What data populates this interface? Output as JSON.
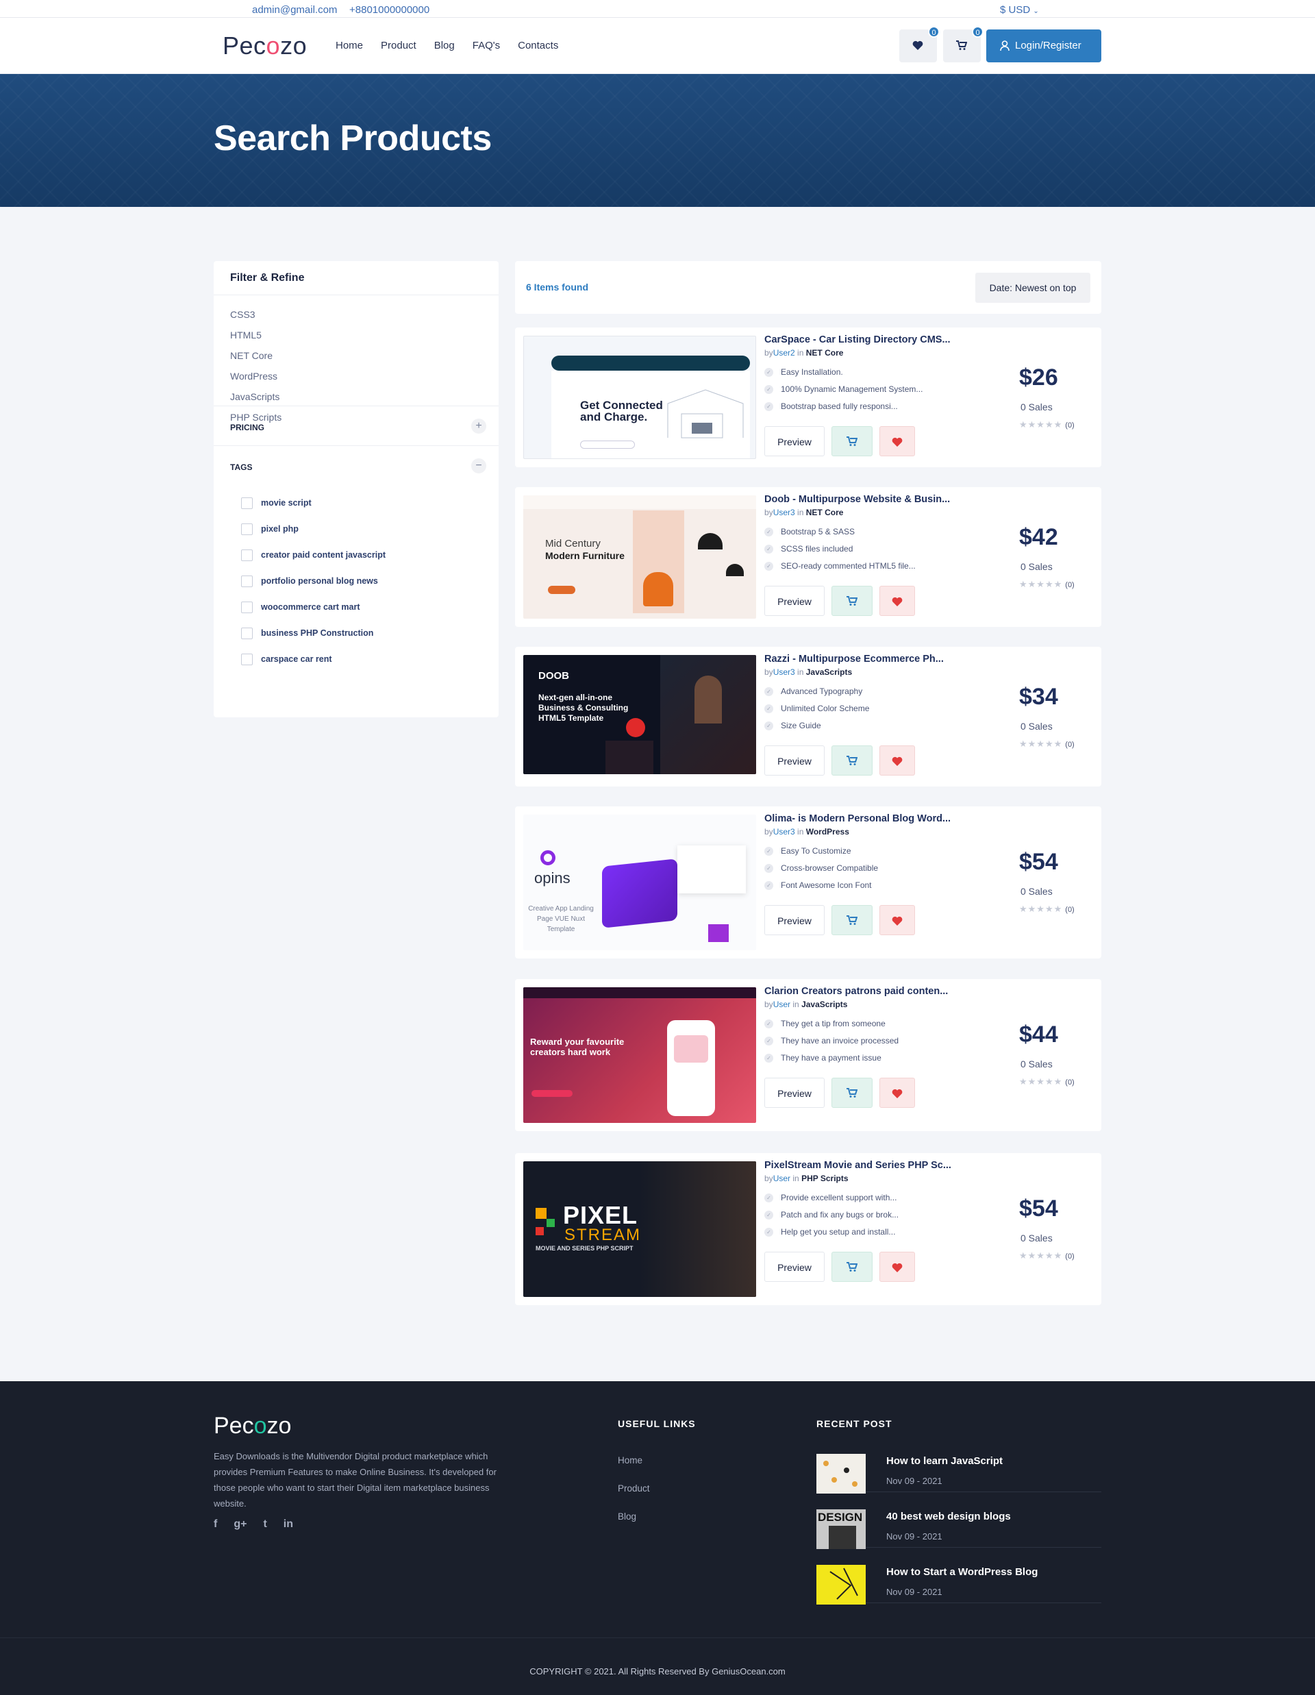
{
  "topbar": {
    "email": "admin@gmail.com",
    "phone": "+8801000000000",
    "currency": "$  USD"
  },
  "header": {
    "logo": "Pecozo",
    "nav": [
      "Home",
      "Product",
      "Blog",
      "FAQ's",
      "Contacts"
    ],
    "wishlist_count": "0",
    "cart_count": "0",
    "login_label": "Login/Register"
  },
  "hero": {
    "title": "Search Products"
  },
  "sidebar": {
    "title": "Filter & Refine",
    "categories": [
      "CSS3",
      "HTML5",
      "NET Core",
      "WordPress",
      "JavaScripts",
      "PHP Scripts"
    ],
    "pricing_label": "PRICING",
    "tags_label": "TAGS",
    "tags": [
      "movie script",
      "pixel php",
      "creator paid content javascript",
      "portfolio personal blog news",
      "woocommerce cart mart",
      "business PHP Construction",
      "carspace car rent"
    ]
  },
  "results": {
    "found": "6 Items found",
    "sort": "Date: Newest on top"
  },
  "products": [
    {
      "name": "CarSpace - Car Listing Directory CMS...",
      "by": "by",
      "user": "User2",
      "in": "in",
      "category": "NET Core",
      "features": [
        "Easy Installation.",
        "100% Dynamic Management System...",
        "Bootstrap based fully responsi..."
      ],
      "price": "$26",
      "sales": "0 Sales",
      "rating": "(0)",
      "thumb_text": "Get Connected and Charge."
    },
    {
      "name": "Doob - Multipurpose Website & Busin...",
      "by": "by",
      "user": "User3",
      "in": "in",
      "category": "NET Core",
      "features": [
        "Bootstrap 5 & SASS",
        "SCSS files included",
        "SEO-ready commented HTML5 file..."
      ],
      "price": "$42",
      "sales": "0 Sales",
      "rating": "(0)",
      "thumb_text": "Mid Century",
      "thumb_text2": "Modern Furniture"
    },
    {
      "name": "Razzi - Multipurpose Ecommerce Ph...",
      "by": "by",
      "user": "User3",
      "in": "in",
      "category": "JavaScripts",
      "features": [
        "Advanced Typography",
        "Unlimited Color Scheme",
        "Size Guide"
      ],
      "price": "$34",
      "sales": "0 Sales",
      "rating": "(0)",
      "thumb_text": "DOOB",
      "thumb_text2": "Next-gen all-in-one Business & Consulting HTML5 Template"
    },
    {
      "name": "Olima- is Modern Personal Blog Word...",
      "by": "by",
      "user": "User3",
      "in": "in",
      "category": "WordPress",
      "features": [
        "Easy To Customize",
        "Cross-browser Compatible",
        "Font Awesome Icon Font"
      ],
      "price": "$54",
      "sales": "0 Sales",
      "rating": "(0)",
      "thumb_text": "opins",
      "thumb_text2": "Creative App Landing Page VUE Nuxt Template"
    },
    {
      "name": "Clarion Creators patrons paid conten...",
      "by": "by",
      "user": "User",
      "in": "in",
      "category": "JavaScripts",
      "features": [
        "They get a tip from someone",
        "They have an invoice processed",
        "They have a payment issue"
      ],
      "price": "$44",
      "sales": "0 Sales",
      "rating": "(0)",
      "thumb_text": "Reward your favourite creators hard work"
    },
    {
      "name": "PixelStream Movie and Series PHP Sc...",
      "by": "by",
      "user": "User",
      "in": "in",
      "category": "PHP Scripts",
      "features": [
        "Provide excellent support with...",
        "Patch and fix any bugs or brok...",
        "Help get you setup and install..."
      ],
      "price": "$54",
      "sales": "0 Sales",
      "rating": "(0)",
      "thumb_text": "PIXEL",
      "thumb_text2": "STREAM",
      "thumb_text3": "MOVIE AND SERIES PHP SCRIPT"
    }
  ],
  "buttons": {
    "preview": "Preview"
  },
  "footer": {
    "logo": "Pecozo",
    "description": "Easy Downloads is the Multivendor Digital product marketplace which provides Premium Features to make Online Business. It's developed for those people who want to start their Digital item marketplace business website.",
    "social": [
      "f",
      "g+",
      "t",
      "in"
    ],
    "useful_links_title": "USEFUL LINKS",
    "useful_links": [
      "Home",
      "Product",
      "Blog"
    ],
    "recent_post_title": "RECENT POST",
    "posts": [
      {
        "title": "How to learn JavaScript",
        "date": "Nov 09 - 2021"
      },
      {
        "title": "40 best web design blogs",
        "date": "Nov 09 - 2021",
        "img_text": "DESIGN"
      },
      {
        "title": "How to Start a WordPress Blog",
        "date": "Nov 09 - 2021"
      }
    ],
    "copyright": "COPYRIGHT © 2021. All Rights Reserved By GeniusOcean.com"
  },
  "colors": {
    "primary": "#2d7cc0",
    "hero": "#1d4473",
    "footer": "#1a1f2b",
    "title": "#1f2f5c"
  }
}
